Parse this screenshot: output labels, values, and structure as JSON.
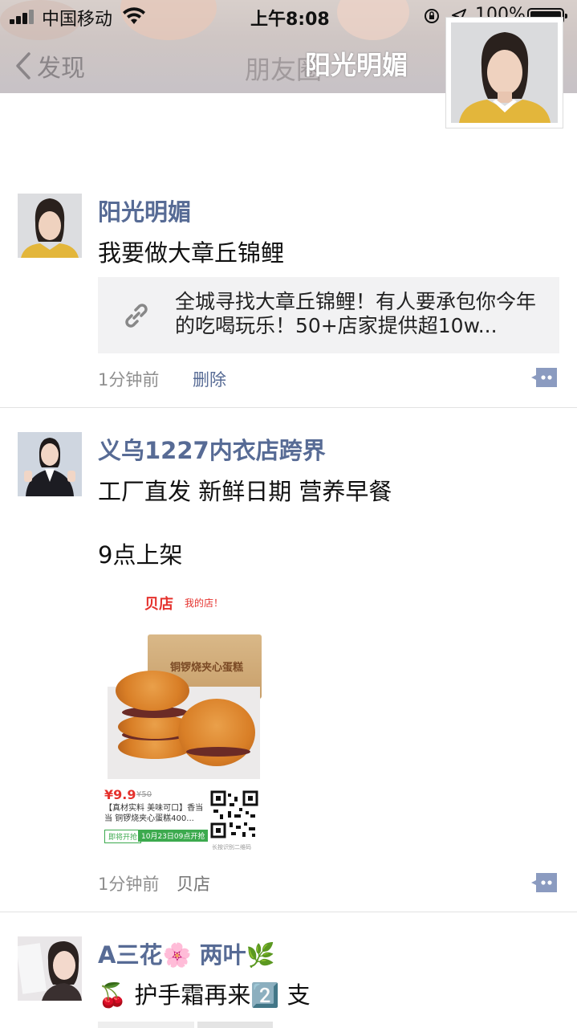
{
  "status_bar": {
    "carrier": "中国移动",
    "time": "上午8:08",
    "battery": "100%"
  },
  "nav": {
    "back_label": "发现",
    "title_faded": "朋友圈",
    "title": "阳光明媚"
  },
  "posts": [
    {
      "name": "阳光明媚",
      "text": "我要做大章丘锦鲤",
      "link_title": "全城寻找大章丘锦鲤！有人要承包你今年的吃喝玩乐！50+店家提供超10w...",
      "time": "1分钟前",
      "delete_label": "删除"
    },
    {
      "name": "义乌1227内衣店跨界",
      "text_line1": "工厂直发 新鲜日期 营养早餐",
      "text_line2": "9点上架",
      "time": "1分钟前",
      "source": "贝店",
      "image": {
        "brand": "贝店",
        "brand_slogan": "我的店！",
        "box_label": "铜锣烧夹心蛋糕",
        "price": "¥9.9",
        "price_old": "¥50",
        "description": "【真材实料 美味可口】香当当 铜锣烧夹心蛋糕400...",
        "tag_soon": "即将开抢",
        "tag_date": "10月23日09点开抢",
        "qr_caption": "长按识别二维码"
      }
    },
    {
      "name": "A三花🌸 两叶🌿",
      "text": "🍒 护手霜再来2️⃣ 支"
    }
  ],
  "colors": {
    "name_link": "#576b95",
    "link_card_bg": "#f2f2f3",
    "meta_gray": "#8f8f8f"
  }
}
